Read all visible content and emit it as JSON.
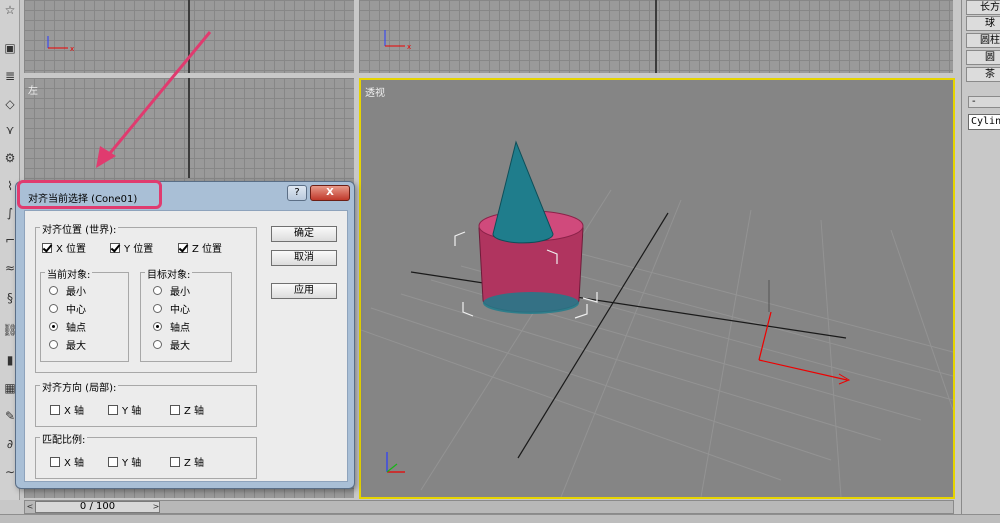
{
  "viewports": {
    "left_label": "左",
    "perspective_label": "透视"
  },
  "command_panel": {
    "object_buttons": [
      "长方",
      "球",
      "圆柱",
      "圆",
      "茶"
    ],
    "rollout_minus": "-",
    "name_field_value": "Cylin"
  },
  "time_slider": {
    "thumb_label": "0 / 100",
    "left_arrow": "<",
    "right_arrow": ">"
  },
  "dialog": {
    "title": "对齐当前选择 (Cone01)",
    "help_label": "?",
    "close_label": "X",
    "align_position": {
      "group_label": "对齐位置 (世界):",
      "x_label": "X 位置",
      "y_label": "Y 位置",
      "z_label": "Z 位置",
      "x_checked": true,
      "y_checked": true,
      "z_checked": true
    },
    "current_object": {
      "group_label": "当前对象:",
      "options": [
        "最小",
        "中心",
        "轴点",
        "最大"
      ],
      "selected": "轴点"
    },
    "target_object": {
      "group_label": "目标对象:",
      "options": [
        "最小",
        "中心",
        "轴点",
        "最大"
      ],
      "selected": "轴点"
    },
    "align_orientation": {
      "group_label": "对齐方向 (局部):",
      "x_label": "X 轴",
      "y_label": "Y 轴",
      "z_label": "Z 轴"
    },
    "match_scale": {
      "group_label": "匹配比例:",
      "x_label": "X 轴",
      "y_label": "Y 轴",
      "z_label": "Z 轴"
    },
    "buttons": {
      "ok": "确定",
      "cancel": "取消",
      "apply": "应用"
    }
  },
  "colors": {
    "cylinder_side": "#b0345f",
    "cylinder_top": "#d04a7c",
    "cone": "#1f7d8c",
    "annotation": "#e03b6f",
    "active_viewport_border": "#e6d400"
  }
}
